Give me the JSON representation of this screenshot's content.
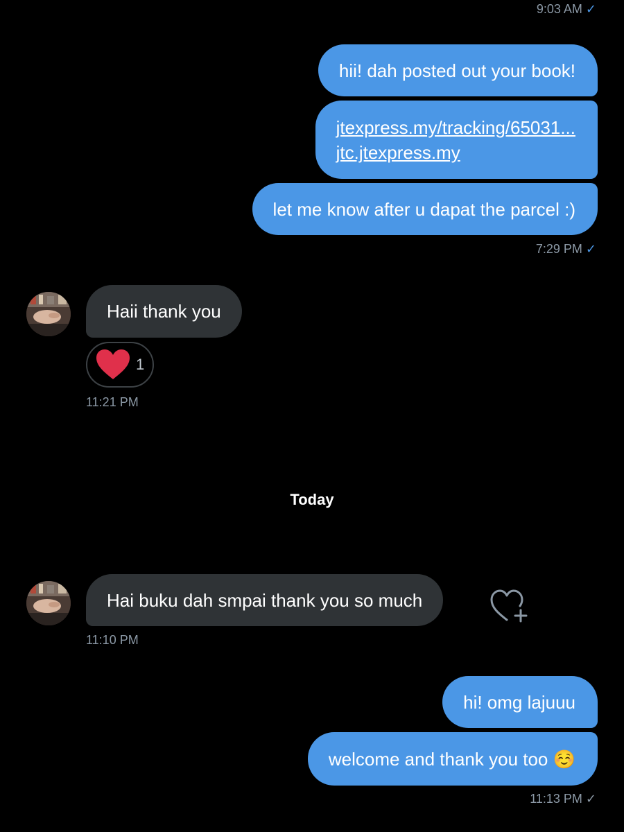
{
  "conversation": {
    "top_timestamp": "9:03 AM",
    "outgoing_group_1": {
      "messages": [
        "hii! dah posted out your book!",
        "let me know after u dapat the parcel :)"
      ],
      "link_lines": [
        "jtexpress.my/tracking/65031...",
        "jtc.jtexpress.my"
      ],
      "timestamp": "7:29 PM"
    },
    "incoming_1": {
      "text": "Haii thank you",
      "reaction_emoji": "red-heart",
      "reaction_count": "1",
      "timestamp": "11:21 PM"
    },
    "day_separator": "Today",
    "incoming_2": {
      "text": "Hai buku dah smpai thank you so much",
      "timestamp": "11:10 PM"
    },
    "outgoing_group_2": {
      "messages": [
        "hi! omg lajuuu",
        "welcome and thank you too ☺️"
      ],
      "timestamp": "11:13 PM"
    },
    "read_check": "✓"
  },
  "colors": {
    "background": "#000000",
    "outgoing_bubble": "#4b97e6",
    "incoming_bubble": "#2f3336",
    "meta_text": "#8b98a5",
    "reaction_heart": "#e0245e"
  },
  "icons": {
    "read_receipt": "checkmark-icon",
    "add_reaction": "heart-plus-icon",
    "avatar": "user-avatar"
  }
}
